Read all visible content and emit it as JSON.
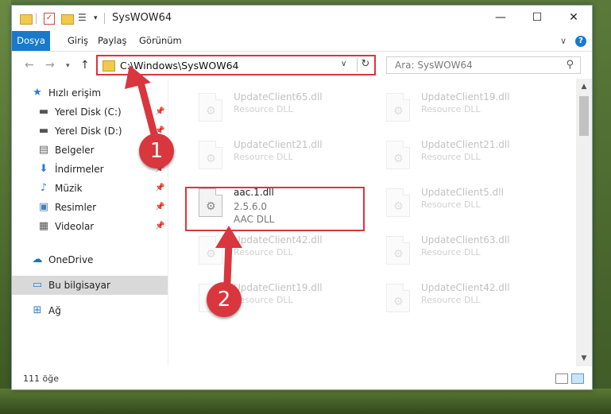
{
  "window": {
    "title": "SysWOW64"
  },
  "ribbon": {
    "tabs": [
      "Dosya",
      "Giriş",
      "Paylaş",
      "Görünüm"
    ]
  },
  "address": {
    "path": "C:\\Windows\\SysWOW64"
  },
  "search": {
    "placeholder": "Ara: SysWOW64"
  },
  "sidebar": {
    "items": [
      {
        "label": "Hızlı erişim",
        "icon": "star-icon"
      },
      {
        "label": "Yerel Disk (C:)",
        "icon": "drive-icon",
        "pinned": true
      },
      {
        "label": "Yerel Disk (D:)",
        "icon": "drive-icon",
        "pinned": true
      },
      {
        "label": "Belgeler",
        "icon": "documents-icon",
        "pinned": true
      },
      {
        "label": "İndirmeler",
        "icon": "download-icon",
        "pinned": true
      },
      {
        "label": "Müzik",
        "icon": "music-icon",
        "pinned": true
      },
      {
        "label": "Resimler",
        "icon": "pictures-icon",
        "pinned": true
      },
      {
        "label": "Videolar",
        "icon": "videos-icon",
        "pinned": true
      },
      {
        "label": "OneDrive",
        "icon": "cloud-icon"
      },
      {
        "label": "Bu bilgisayar",
        "icon": "computer-icon",
        "selected": true
      },
      {
        "label": "Ağ",
        "icon": "network-icon"
      }
    ]
  },
  "files": [
    {
      "name": "UpdateClient65.dll",
      "desc": "Resource DLL"
    },
    {
      "name": "UpdateClient19.dll",
      "desc": "Resource DLL"
    },
    {
      "name": "UpdateClient21.dll",
      "desc": "Resource DLL"
    },
    {
      "name": "UpdateClient21.dll",
      "desc": "Resource DLL"
    },
    {
      "name": "aac.1.dll",
      "version": "2.5.6.0",
      "type": "AAC DLL"
    },
    {
      "name": "UpdateClient5.dll",
      "desc": "Resource DLL"
    },
    {
      "name": "UpdateClient42.dll",
      "desc": "Resource DLL"
    },
    {
      "name": "UpdateClient63.dll",
      "desc": "Resource DLL"
    },
    {
      "name": "UpdateClient19.dll",
      "desc": "Resource DLL"
    },
    {
      "name": "UpdateClient42.dll",
      "desc": "Resource DLL"
    }
  ],
  "status": {
    "count": "111 öğe"
  },
  "callouts": {
    "one": "1",
    "two": "2"
  },
  "colors": {
    "accent": "#1979ca",
    "highlight": "#d9363e"
  }
}
